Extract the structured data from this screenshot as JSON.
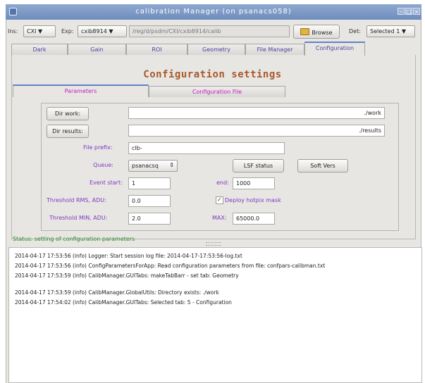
{
  "window": {
    "title": "calibration Manager (on psanacs058)",
    "min": "–",
    "max": "□",
    "close": "×"
  },
  "toolbar": {
    "ins_label": "Ins:",
    "ins_value": "CXI",
    "exp_label": "Exp:",
    "exp_value": "cxib8914",
    "path": "/reg/d/psdm/CXI/cxib8914/calib",
    "browse_label": "Browse",
    "det_label": "Det:",
    "det_value": "Selected 1"
  },
  "tabs": [
    "Dark",
    "Gain",
    "ROI",
    "Geometry",
    "File Manager",
    "Configuration"
  ],
  "heading": "Configuration settings",
  "subtabs": [
    "Parameters",
    "Configuration File"
  ],
  "form": {
    "dir_work_button": "Dir work:",
    "dir_work_value": "./work",
    "dir_results_button": "Dir results:",
    "dir_results_value": "./results",
    "file_prefix_label": "File prefix:",
    "file_prefix_value": "clb-",
    "queue_label": "Queue:",
    "queue_value": "psanacsq",
    "lsf_button": "LSF status",
    "soft_button": "Soft Vers",
    "event_start_label": "Event start:",
    "event_start_value": "1",
    "end_label": "end:",
    "end_value": "1000",
    "thr_rms_label": "Threshold RMS, ADU:",
    "thr_rms_value": "0.0",
    "deploy_label": "Deploy hotpix mask",
    "deploy_check": "✓",
    "thr_min_label": "Threshold MIN, ADU:",
    "thr_min_value": "2.0",
    "max_label": "MAX:",
    "max_value": "65000.0"
  },
  "status": "Status: setting of configuration parameters",
  "log": [
    "2014-04-17 17:53:56 (info) Logger: Start session log file: 2014-04-17-17:53:56-log.txt",
    "2014-04-17 17:53:56 (info) ConfigParametersForApp: Read configuration parameters from file: confpars-calibman.txt",
    "2014-04-17 17:53:59 (info) CalibManager.GUITabs:  makeTabBarr - set tab: Geometry",
    "",
    "2014-04-17 17:53:59 (info) CalibManager.GlobalUtils: Directory exists: ./work",
    "2014-04-17 17:54:02 (info) CalibManager.GUITabs: Selected tab: 5 - Configuration"
  ],
  "colors": {
    "title_bar": "#7b97c6",
    "accent": "#5d83c9",
    "heading": "#a85a2a",
    "label_purple": "#7b3bc0",
    "subtab_magenta": "#c020c0",
    "status_green": "#2a8a2a"
  }
}
